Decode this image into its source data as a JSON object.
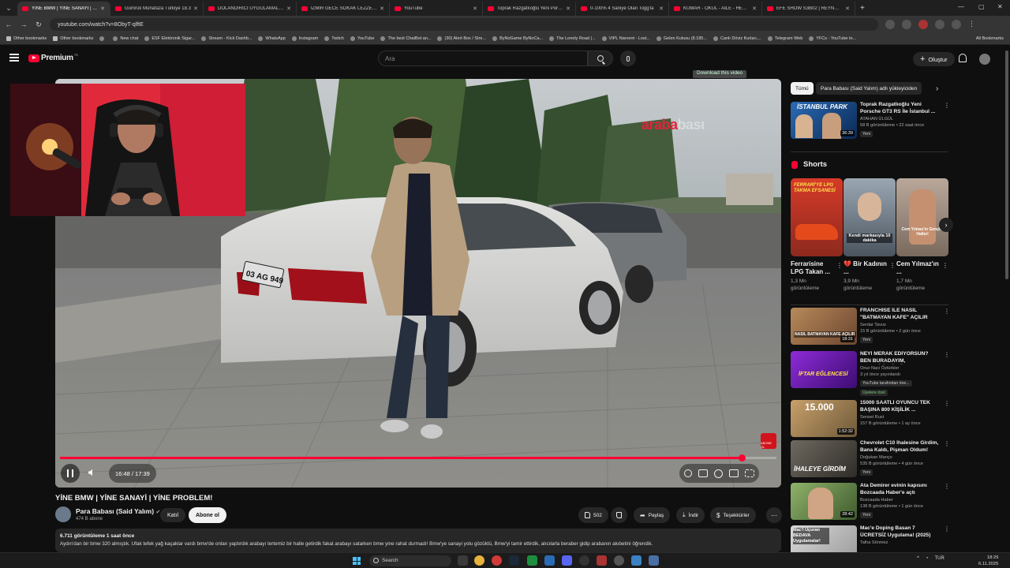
{
  "browser": {
    "tabs": [
      {
        "label": "YİNE BMW | YİNE SANAYİ | YİNE",
        "active": true
      },
      {
        "label": "Gümrük Muhafaza Türkiye 18.3"
      },
      {
        "label": "DOLANDIRICI UYGULAMALARI"
      },
      {
        "label": "İZMİR GECE SOKAK LEZZETLERİ"
      },
      {
        "label": "YouTube"
      },
      {
        "label": "Toprak Razgatlıoğlu Yeni Porsche"
      },
      {
        "label": "0-100% 4 Saniye Olan Togg'la"
      },
      {
        "label": "KUMAR - OKUL - AİLE - HEPSİ"
      },
      {
        "label": "EFE SHOW S3B02 | REYNMEN"
      }
    ],
    "new_tab": "+",
    "url": "youtube.com/watch?v=8ObyT-qlftE",
    "bookmarks": [
      {
        "label": "Other bookmarks",
        "folder": true
      },
      {
        "label": "Other bookmarks",
        "folder": true
      },
      {
        "label": ""
      },
      {
        "label": "New chat"
      },
      {
        "label": "ESF Elektronik Sigar..."
      },
      {
        "label": "Stream - Kick Dashb..."
      },
      {
        "label": "WhatsApp"
      },
      {
        "label": "Instagram"
      },
      {
        "label": "Twitch"
      },
      {
        "label": "YouTube"
      },
      {
        "label": "The best ChatBot an..."
      },
      {
        "label": "(30) Alert Box / Stre..."
      },
      {
        "label": "ByNoGame ByNoCa..."
      },
      {
        "label": "The Lonely Road |..."
      },
      {
        "label": "VIPL Narvent - Lost..."
      },
      {
        "label": "Gelen Kutusu (8.185..."
      },
      {
        "label": "Canlı Döviz Kurları,..."
      },
      {
        "label": "Telegram Web"
      },
      {
        "label": "YFCs - YouTube to..."
      }
    ],
    "all_bookmarks": "All Bookmarks"
  },
  "yt": {
    "logo": "Premium",
    "country": "TR",
    "search_placeholder": "Ara",
    "create_label": "Oluştur"
  },
  "player": {
    "download_chip": "Download this video",
    "watermark_brand": "araba",
    "watermark_faded": "bası",
    "time_current": "16:48",
    "time_total": "17:39",
    "time_display": "16:48 / 17:39",
    "progress": 0.952,
    "sub_logo_text": "ABONE OL"
  },
  "video": {
    "title": "YİNE BMW | YİNE SANAYİ | YİNE PROBLEM!",
    "channel": "Para Babası (Said Yalım)",
    "subscribers": "474 B abone",
    "join_label": "Katıl",
    "subscribe_label": "Abone ol",
    "likes": "502",
    "share_label": "Paylaş",
    "download_label": "İndir",
    "thanks_label": "Teşekkürler",
    "stats": "6.711 görüntüleme  1 saat önce",
    "description": "Aydın'dan bir bmw 320 almıştık. Ufak tefek yağ kaçaklar vardı bmw'de onları yaptırdık arabayı tertemiz bir halle getirdik fakat arabayı satarken bmw yine rahat durmadı! Bmw'ye sanayi yolu gözüktü, Bmw'yi tamir ettirdik, alıcılarla beraber gidip arabanın akıbetini öğrendik."
  },
  "sidebar": {
    "chips": [
      "Tümü",
      "Para Babası (Said Yalım) adlı yükleyiciden"
    ],
    "top_rec": {
      "title": "Toprak Razgatlıoğlu Yeni Porsche GT3 RS İle İstanbul ...",
      "channel": "ATAHAN ÜLGÜL",
      "meta": "58 B görüntüleme • 22 saat önce",
      "badge": "Yeni",
      "duration": "36:39",
      "thumb_text": "İSTANBUL PARK"
    },
    "shorts_title": "Shorts",
    "shorts": [
      {
        "title": "Ferrarisine LPG Takan ...",
        "views": "1,3 Mn görüntüleme",
        "thumb_text": "FERRARİ'YE LPG TAKMA EFSANESİ"
      },
      {
        "title": "💔 Bir Kadının ...",
        "views": "3,9 Mn görüntüleme",
        "thumb_text": "Kendi markasıyla 10 dakika"
      },
      {
        "title": "Cem Yılmaz'ın ...",
        "views": "1,7 Mn görüntüleme",
        "thumb_text": "Cem Yılmaz'ın Gençlik Halleri"
      }
    ],
    "recs": [
      {
        "title": "FRANCHİSE İLE NASIL \"BATMAYAN KAFE\" AÇILIR",
        "channel": "Serdar Tavus",
        "meta": "15 B görüntüleme • 2 gün önce",
        "badge": "Yeni",
        "duration": "18:31",
        "thumb_text": "NASIL BATMAYAN KAFE AÇILIR"
      },
      {
        "title": "NEYİ MERAK EDİYORSUN? BEN BURADAYIM, SORABİLİRSİN 😊",
        "channel": "Onur Naci Öztürkler",
        "meta": "3 yıl önce yayınlandı",
        "badge": "YouTube tarafından öne...",
        "badge2": "Üyelere özel",
        "duration": "",
        "thumb_text": "İFTAR EĞLENCESİ"
      },
      {
        "title": "15000 SAATLİ OYUNCU TEK BAŞINA 800 KİŞİLİK ...",
        "channel": "Sensei Rust",
        "meta": "157 B görüntüleme • 1 ay önce",
        "badge": "",
        "duration": "1:52:32",
        "thumb_text": "15.000"
      },
      {
        "title": "Chevrolet C10 İhalesine Girdim, Bana Kaldı, Pişman Oldum!",
        "channel": "Doğukan Manço",
        "meta": "535 B görüntüleme • 4 gün önce",
        "badge": "Yeni",
        "duration": "",
        "thumb_text": "İHALEYE GİRDİM"
      },
      {
        "title": "Ata Demirer evinin kapısını Bozcaada Haber'e açtı",
        "channel": "Bozcaada Haber",
        "meta": "138 B görüntüleme • 1 gün önce",
        "badge": "Yeni",
        "duration": "28:42",
        "thumb_text": ""
      },
      {
        "title": "Mac'e Doping Basan 7 ÜCRETSİZ Uygulama! (2025)",
        "channel": "Talha Sönmez",
        "meta": "",
        "badge": "",
        "duration": "",
        "thumb_text": "Mac'i Uçuran BEDAVA Uygulamalar!"
      }
    ]
  },
  "taskbar": {
    "search": "Search",
    "lang": "TUR",
    "time": "18:29",
    "date": "6.11.2025"
  },
  "colors": {
    "yt_red": "#ff0033",
    "bg": "#0f0f0f",
    "surface": "#272727",
    "text": "#f1f1f1"
  }
}
